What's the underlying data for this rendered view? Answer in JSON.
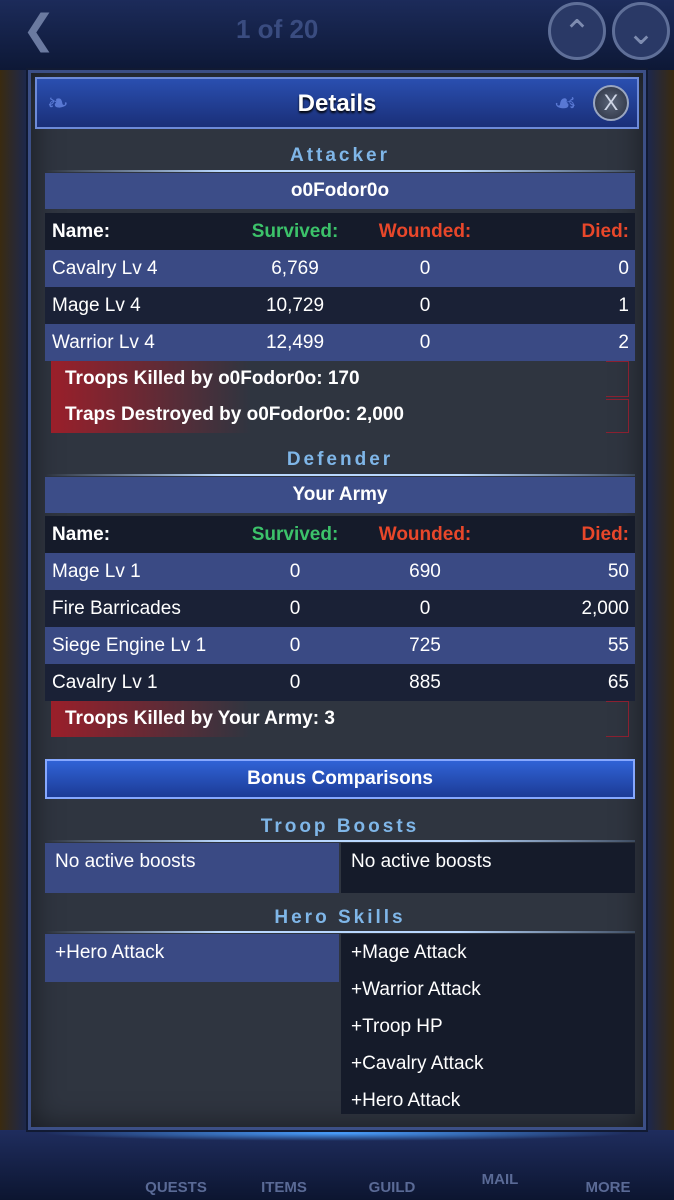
{
  "background": {
    "page_indicator": "1 of 20",
    "tabs": [
      "QUESTS",
      "ITEMS",
      "GUILD",
      "MAIL",
      "MORE"
    ]
  },
  "dialog": {
    "title": "Details",
    "close_label": "X",
    "attacker": {
      "section_label": "Attacker",
      "player_name": "o0Fodor0o",
      "headers": {
        "name": "Name:",
        "survived": "Survived:",
        "wounded": "Wounded:",
        "died": "Died:"
      },
      "rows": [
        {
          "name": "Cavalry Lv 4",
          "survived": "6,769",
          "wounded": "0",
          "died": "0"
        },
        {
          "name": "Mage Lv 4",
          "survived": "10,729",
          "wounded": "0",
          "died": "1"
        },
        {
          "name": "Warrior Lv 4",
          "survived": "12,499",
          "wounded": "0",
          "died": "2"
        }
      ],
      "troops_killed": "Troops Killed by o0Fodor0o: 170",
      "traps_destroyed": "Traps Destroyed by o0Fodor0o: 2,000"
    },
    "defender": {
      "section_label": "Defender",
      "player_name": "Your Army",
      "headers": {
        "name": "Name:",
        "survived": "Survived:",
        "wounded": "Wounded:",
        "died": "Died:"
      },
      "rows": [
        {
          "name": "Mage Lv 1",
          "survived": "0",
          "wounded": "690",
          "died": "50"
        },
        {
          "name": "Fire Barricades",
          "survived": "0",
          "wounded": "0",
          "died": "2,000"
        },
        {
          "name": "Siege Engine Lv 1",
          "survived": "0",
          "wounded": "725",
          "died": "55"
        },
        {
          "name": "Cavalry Lv 1",
          "survived": "0",
          "wounded": "885",
          "died": "65"
        }
      ],
      "troops_killed": "Troops Killed by Your Army: 3"
    },
    "bonus_label": "Bonus Comparisons",
    "troop_boosts": {
      "section_label": "Troop Boosts",
      "left": "No active boosts",
      "right": "No active boosts"
    },
    "hero_skills": {
      "section_label": "Hero Skills",
      "left": [
        "+Hero Attack"
      ],
      "right": [
        "+Mage Attack",
        "+Warrior Attack",
        "+Troop HP",
        "+Cavalry Attack",
        "+Hero Attack"
      ]
    }
  }
}
